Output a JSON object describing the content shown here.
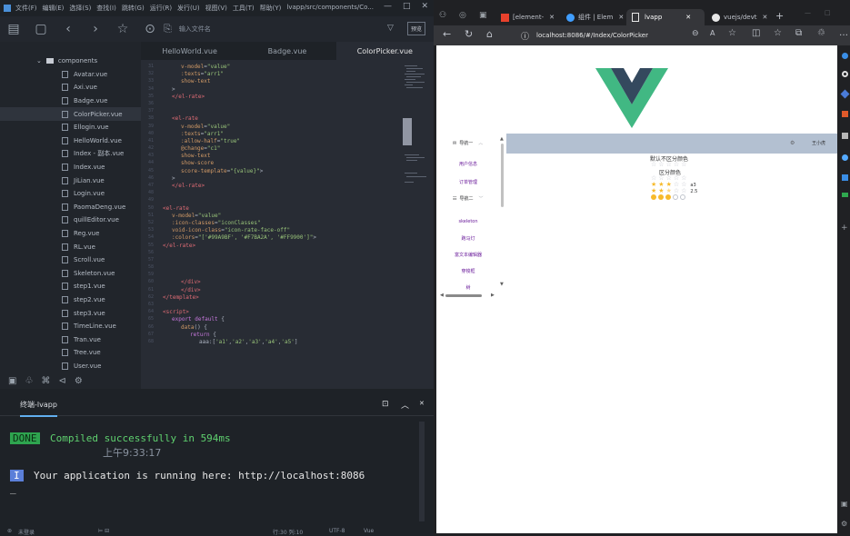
{
  "editor": {
    "menu": [
      "文件(F)",
      "编辑(E)",
      "选择(S)",
      "查找(I)",
      "跳转(G)",
      "运行(R)",
      "发行(U)",
      "视图(V)",
      "工具(T)",
      "帮助(Y)",
      "lvapp/src/components/Co..."
    ],
    "window_controls": [
      "—",
      "□",
      "✕"
    ],
    "search_placeholder": "输入文件名",
    "preview_label": "预览",
    "explorer": {
      "folder": "components",
      "files": [
        "Avatar.vue",
        "Axi.vue",
        "Badge.vue",
        "ColorPicker.vue",
        "Ellogin.vue",
        "HelloWorld.vue",
        "Index - 副本.vue",
        "Index.vue",
        "JiLian.vue",
        "Login.vue",
        "PaomaDeng.vue",
        "quillEditor.vue",
        "Reg.vue",
        "RL.vue",
        "Scroll.vue",
        "Skeleton.vue",
        "step1.vue",
        "step2.vue",
        "step3.vue",
        "TimeLine.vue",
        "Tran.vue",
        "Tree.vue",
        "User.vue"
      ],
      "selected": "ColorPicker.vue"
    },
    "tabs": [
      "HelloWorld.vue",
      "Badge.vue",
      "ColorPicker.vue"
    ],
    "active_tab": "ColorPicker.vue",
    "code_lines": [
      {
        "n": "31",
        "html": "<span class='a'>v-model</span><span class='p'>=</span><span class='s'>\"value\"</span>",
        "i": 2
      },
      {
        "n": "32",
        "html": "<span class='a'>:texts</span><span class='p'>=</span><span class='s'>\"arr1\"</span>",
        "i": 2
      },
      {
        "n": "33",
        "html": "<span class='a'>show-text</span>",
        "i": 2
      },
      {
        "n": "34",
        "html": "<span class='p'>&gt;</span>",
        "i": 1
      },
      {
        "n": "35",
        "html": "<span class='t'>&lt;/el-rate&gt;</span>",
        "i": 1
      },
      {
        "n": "36",
        "html": "",
        "i": 0
      },
      {
        "n": "37",
        "html": "",
        "i": 0
      },
      {
        "n": "38",
        "html": "<span class='t'>&lt;el-rate</span>",
        "i": 1
      },
      {
        "n": "39",
        "html": "<span class='a'>v-model</span><span class='p'>=</span><span class='s'>\"value\"</span>",
        "i": 2
      },
      {
        "n": "40",
        "html": "<span class='a'>:texts</span><span class='p'>=</span><span class='s'>\"arr1\"</span>",
        "i": 2
      },
      {
        "n": "41",
        "html": "<span class='a'>:allow-half</span><span class='p'>=</span><span class='s'>\"true\"</span>",
        "i": 2
      },
      {
        "n": "42",
        "html": "<span class='a'>@change</span><span class='p'>=</span><span class='s'>\"c1\"</span>",
        "i": 2
      },
      {
        "n": "43",
        "html": "<span class='a'>show-text</span>",
        "i": 2
      },
      {
        "n": "44",
        "html": "<span class='a'>show-score</span>",
        "i": 2
      },
      {
        "n": "45",
        "html": "<span class='a'>score-template</span><span class='p'>=</span><span class='s'>\"{value}\"</span><span class='p'>&gt;</span>",
        "i": 2
      },
      {
        "n": "46",
        "html": "<span class='p'>&gt;</span>",
        "i": 1
      },
      {
        "n": "47",
        "html": "<span class='t'>&lt;/el-rate&gt;</span>",
        "i": 1
      },
      {
        "n": "48",
        "html": "",
        "i": 0
      },
      {
        "n": "49",
        "html": "",
        "i": 0
      },
      {
        "n": "50",
        "html": "<span class='t'>&lt;el-rate</span>",
        "i": 0
      },
      {
        "n": "51",
        "html": "<span class='a'>v-model</span><span class='p'>=</span><span class='s'>\"value\"</span>",
        "i": 1
      },
      {
        "n": "52",
        "html": "<span class='a'>:icon-classes</span><span class='p'>=</span><span class='s'>\"iconClasses\"</span>",
        "i": 1
      },
      {
        "n": "53",
        "html": "<span class='a'>void-icon-class</span><span class='p'>=</span><span class='s'>\"icon-rate-face-off\"</span>",
        "i": 1
      },
      {
        "n": "54",
        "html": "<span class='a'>:colors</span><span class='p'>=</span><span class='s'>\"['#99A9BF', '#F7BA2A', '#FF9900']\"</span><span class='p'>&gt;</span>",
        "i": 1
      },
      {
        "n": "55",
        "html": "<span class='t'>&lt;/el-rate&gt;</span>",
        "i": 0
      },
      {
        "n": "56",
        "html": "",
        "i": 0
      },
      {
        "n": "57",
        "html": "",
        "i": 0
      },
      {
        "n": "58",
        "html": "",
        "i": 0
      },
      {
        "n": "59",
        "html": "",
        "i": 0
      },
      {
        "n": "60",
        "html": "<span class='t'>&lt;/div&gt;</span>",
        "i": 2
      },
      {
        "n": "61",
        "html": "<span class='t'>&lt;/div&gt;</span>",
        "i": 2
      },
      {
        "n": "62",
        "html": "<span class='t'>&lt;/template&gt;</span>",
        "i": 0
      },
      {
        "n": "63",
        "html": "",
        "i": 0
      },
      {
        "n": "64",
        "html": "<span class='t'>&lt;script&gt;</span>",
        "i": 0
      },
      {
        "n": "65",
        "html": "<span class='k'>export default</span><span class='p'> {</span>",
        "i": 1
      },
      {
        "n": "66",
        "html": "<span class='a'>data</span><span class='p'>() {</span>",
        "i": 2
      },
      {
        "n": "67",
        "html": "<span class='k'>return</span><span class='p'> {</span>",
        "i": 3
      },
      {
        "n": "68",
        "html": "<span class='p'>aaa:[</span><span class='s'>'a1'</span><span class='p'>,</span><span class='s'>'a2'</span><span class='p'>,</span><span class='s'>'a3'</span><span class='p'>,</span><span class='s'>'a4'</span><span class='p'>,</span><span class='s'>'a5'</span><span class='p'>]</span>",
        "i": 4
      }
    ],
    "terminal": {
      "tab": "终端-lvapp",
      "done_badge": "DONE",
      "compiled": "Compiled successfully in 594ms",
      "time": "上午9:33:17",
      "info_badge": "I",
      "running": "Your application is running here: http://localhost:8086",
      "cursor": "_"
    },
    "statusbar": {
      "left": "未登录",
      "pos": "行:30  列:10",
      "encoding": "UTF-8",
      "lang": "Vue"
    }
  },
  "browser": {
    "tabs": [
      "[element-",
      "组件 | Elem",
      "lvapp",
      "vuejs/devt"
    ],
    "active_tab": "lvapp",
    "url": "localhost:8086/#/Index/ColorPicker",
    "page": {
      "nav1": "导航一",
      "links1": [
        "用户信息",
        "订单管理"
      ],
      "nav2": "导航二",
      "links2": [
        "skeleton",
        "跑马灯",
        "富文本编辑器",
        "穿梭框",
        "树"
      ],
      "header_user": "王小虎",
      "rate_label1": "默认不区分颜色",
      "rate_label2": "区分颜色",
      "rate_texts": [
        "a3",
        "2.5"
      ],
      "colors": {
        "star_on": "#f7ba2a",
        "star_off": "#c0c4cc",
        "face": "#f7ba2a",
        "header": "#b3c0d1",
        "brand_green": "#41b883",
        "brand_dark": "#34495e"
      }
    }
  }
}
